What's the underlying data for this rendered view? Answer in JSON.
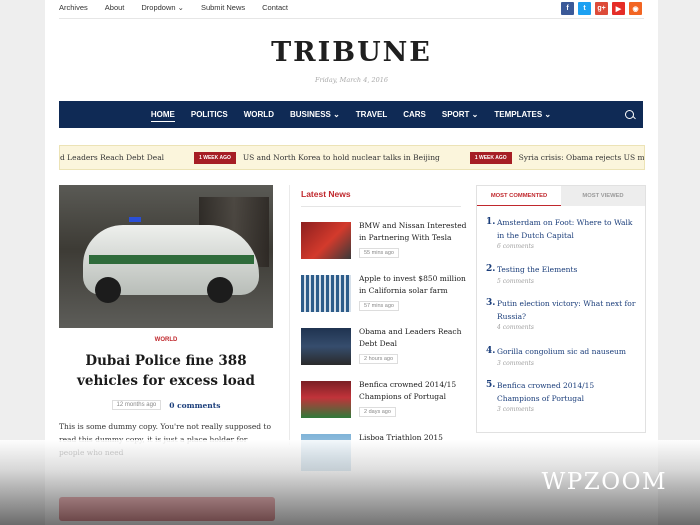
{
  "topnav": {
    "items": [
      "Archives",
      "About",
      "Dropdown ⌄",
      "Submit News",
      "Contact"
    ]
  },
  "social": [
    {
      "icon": "facebook-icon",
      "glyph": "f",
      "color": "#3b5998"
    },
    {
      "icon": "twitter-icon",
      "glyph": "t",
      "color": "#1da1f2"
    },
    {
      "icon": "googleplus-icon",
      "glyph": "g+",
      "color": "#dd4b39"
    },
    {
      "icon": "youtube-icon",
      "glyph": "▶",
      "color": "#e52d27"
    },
    {
      "icon": "rss-icon",
      "glyph": "◉",
      "color": "#f26522"
    }
  ],
  "header": {
    "logo": "TRIBUNE",
    "date": "Friday, March 4, 2016"
  },
  "mainnav": {
    "items": [
      "HOME",
      "POLITICS",
      "WORLD",
      "BUSINESS ⌄",
      "TRAVEL",
      "CARS",
      "SPORT ⌄",
      "TEMPLATES ⌄"
    ],
    "active": "HOME"
  },
  "ticker": {
    "first": "d Leaders Reach Debt Deal",
    "badge1": "1 WEEK AGO",
    "second": "US and North Korea to hold nuclear talks in Beijing",
    "badge2": "1 WEEK AGO",
    "third": "Syria crisis: Obama rejects US military inte"
  },
  "featured": {
    "category": "WORLD",
    "title": "Dubai Police fine 388 vehicles for excess load",
    "ago": "12 months ago",
    "comments": "0 comments",
    "excerpt": "This is some dummy copy. You're not really supposed to read this dummy copy, it is just a place holder for people who need"
  },
  "latest": {
    "heading": "Latest News",
    "items": [
      {
        "title": "BMW and Nissan Interested in Partnering With Tesla",
        "ago": "55 mins ago"
      },
      {
        "title": "Apple to invest $850 million in California solar farm",
        "ago": "57 mins ago"
      },
      {
        "title": "Obama and Leaders Reach Debt Deal",
        "ago": "2 hours ago"
      },
      {
        "title": "Benfica crowned 2014/15 Champions of Portugal",
        "ago": "2 days ago"
      },
      {
        "title": "Lisboa Triathlon 2015",
        "ago": ""
      }
    ]
  },
  "sidebar": {
    "tab_active": "MOST COMMENTED",
    "tab_other": "MOST VIEWED",
    "items": [
      {
        "num": "1.",
        "title": "Amsterdam on Foot: Where to Walk in the Dutch Capital",
        "comments": "6 comments"
      },
      {
        "num": "2.",
        "title": "Testing the Elements",
        "comments": "5 comments"
      },
      {
        "num": "3.",
        "title": "Putin election victory: What next for Russia?",
        "comments": "4 comments"
      },
      {
        "num": "4.",
        "title": "Gorilla congolium sic ad nauseum",
        "comments": "3 comments"
      },
      {
        "num": "5.",
        "title": "Benfica crowned 2014/15 Champions of Portugal",
        "comments": "3 comments"
      }
    ]
  },
  "watermark": "WPZOOM"
}
